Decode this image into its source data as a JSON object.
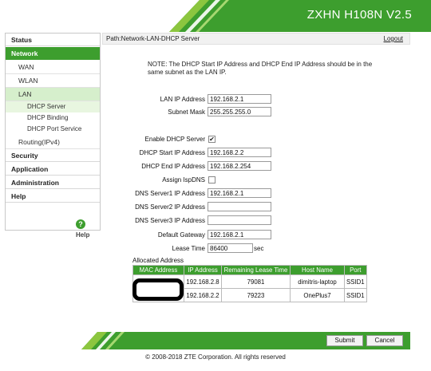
{
  "header": {
    "title": "ZXHN H108N V2.5"
  },
  "sidebar": {
    "status": "Status",
    "network": "Network",
    "wan": "WAN",
    "wlan": "WLAN",
    "lan": "LAN",
    "dhcp_server": "DHCP Server",
    "dhcp_binding": "DHCP Binding",
    "dhcp_port_service": "DHCP Port Service",
    "routing": "Routing(IPv4)",
    "security": "Security",
    "application": "Application",
    "administration": "Administration",
    "help": "Help",
    "help_link": "Help"
  },
  "path": {
    "text": "Path:Network-LAN-DHCP Server",
    "logout": "Logout"
  },
  "note": "NOTE: The DHCP Start IP Address and DHCP End IP Address should be in the same subnet as the LAN IP.",
  "form": {
    "lan_ip_label": "LAN IP Address",
    "lan_ip": "192.168.2.1",
    "subnet_label": "Subnet Mask",
    "subnet": "255.255.255.0",
    "enable_dhcp_label": "Enable DHCP Server",
    "enable_dhcp_checked": true,
    "start_ip_label": "DHCP Start IP Address",
    "start_ip": "192.168.2.2",
    "end_ip_label": "DHCP End IP Address",
    "end_ip": "192.168.2.254",
    "assign_isp_dns_label": "Assign IspDNS",
    "assign_isp_dns_checked": false,
    "dns1_label": "DNS Server1 IP Address",
    "dns1": "192.168.2.1",
    "dns2_label": "DNS Server2 IP Address",
    "dns2": "",
    "dns3_label": "DNS Server3 IP Address",
    "dns3": "",
    "gateway_label": "Default Gateway",
    "gateway": "192.168.2.1",
    "lease_label": "Lease Time",
    "lease": "86400",
    "lease_unit": "sec"
  },
  "allocated": {
    "label": "Allocated Address",
    "headers": [
      "MAC Address",
      "IP Address",
      "Remaining Lease Time",
      "Host Name",
      "Port"
    ],
    "rows": [
      {
        "mac": "",
        "ip": "192.168.2.8",
        "lease": "79081",
        "host": "dimitris-laptop",
        "port": "SSID1"
      },
      {
        "mac": "",
        "ip": "192.168.2.2",
        "lease": "79223",
        "host": "OnePlus7",
        "port": "SSID1"
      }
    ]
  },
  "buttons": {
    "submit": "Submit",
    "cancel": "Cancel"
  },
  "footer": {
    "copyright": "© 2008-2018 ZTE Corporation. All rights reserved"
  },
  "colors": {
    "brand_green": "#3d9e2e",
    "light_green": "#8cc63f",
    "active_sub": "#d6efcc"
  }
}
